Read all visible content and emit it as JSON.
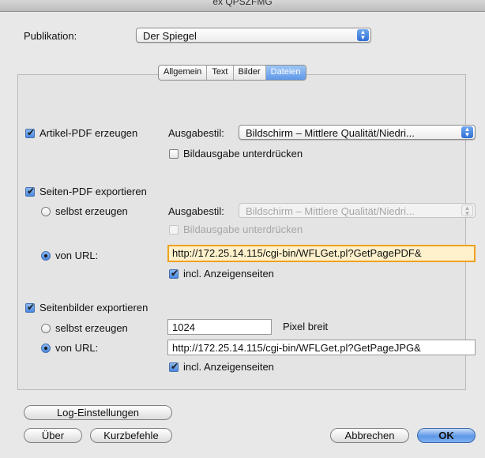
{
  "window": {
    "title": "ex QPSZFMG"
  },
  "publikation": {
    "label": "Publikation:",
    "value": "Der Spiegel"
  },
  "tabs": [
    {
      "label": "Allgemein",
      "active": false
    },
    {
      "label": "Text",
      "active": false
    },
    {
      "label": "Bilder",
      "active": false
    },
    {
      "label": "Dateien",
      "active": true
    }
  ],
  "artikel_pdf": {
    "checkbox_label": "Artikel-PDF erzeugen",
    "checked": true,
    "ausgabestil_label": "Ausgabestil:",
    "ausgabestil_value": "Bildschirm – Mittlere Qualität/Niedri...",
    "bildausgabe_label": "Bildausgabe unterdrücken",
    "bildausgabe_checked": false
  },
  "seiten_pdf": {
    "checkbox_label": "Seiten-PDF exportieren",
    "checked": true,
    "radio_selbst_label": "selbst erzeugen",
    "ausgabestil_label": "Ausgabestil:",
    "ausgabestil_value": "Bildschirm – Mittlere Qualität/Niedri...",
    "bildausgabe_label": "Bildausgabe unterdrücken",
    "radio_url_label": "von URL:",
    "url_value": "http://172.25.14.115/cgi-bin/WFLGet.pl?GetPagePDF&",
    "incl_label": "incl. Anzeigenseiten",
    "incl_checked": true
  },
  "seitenbilder": {
    "checkbox_label": "Seitenbilder exportieren",
    "checked": true,
    "radio_selbst_label": "selbst erzeugen",
    "pixel_value": "1024",
    "pixel_unit_label": "Pixel breit",
    "radio_url_label": "von URL:",
    "url_value": "http://172.25.14.115/cgi-bin/WFLGet.pl?GetPageJPG&",
    "incl_label": "incl. Anzeigenseiten",
    "incl_checked": true
  },
  "buttons": {
    "log": "Log-Einstellungen",
    "ueber": "Über",
    "kurzbefehle": "Kurzbefehle",
    "abbrechen": "Abbrechen",
    "ok": "OK"
  },
  "colors": {
    "accent": "#5e98e8",
    "focus_field_bg": "#fff1cc",
    "focus_border": "#f0a020"
  }
}
